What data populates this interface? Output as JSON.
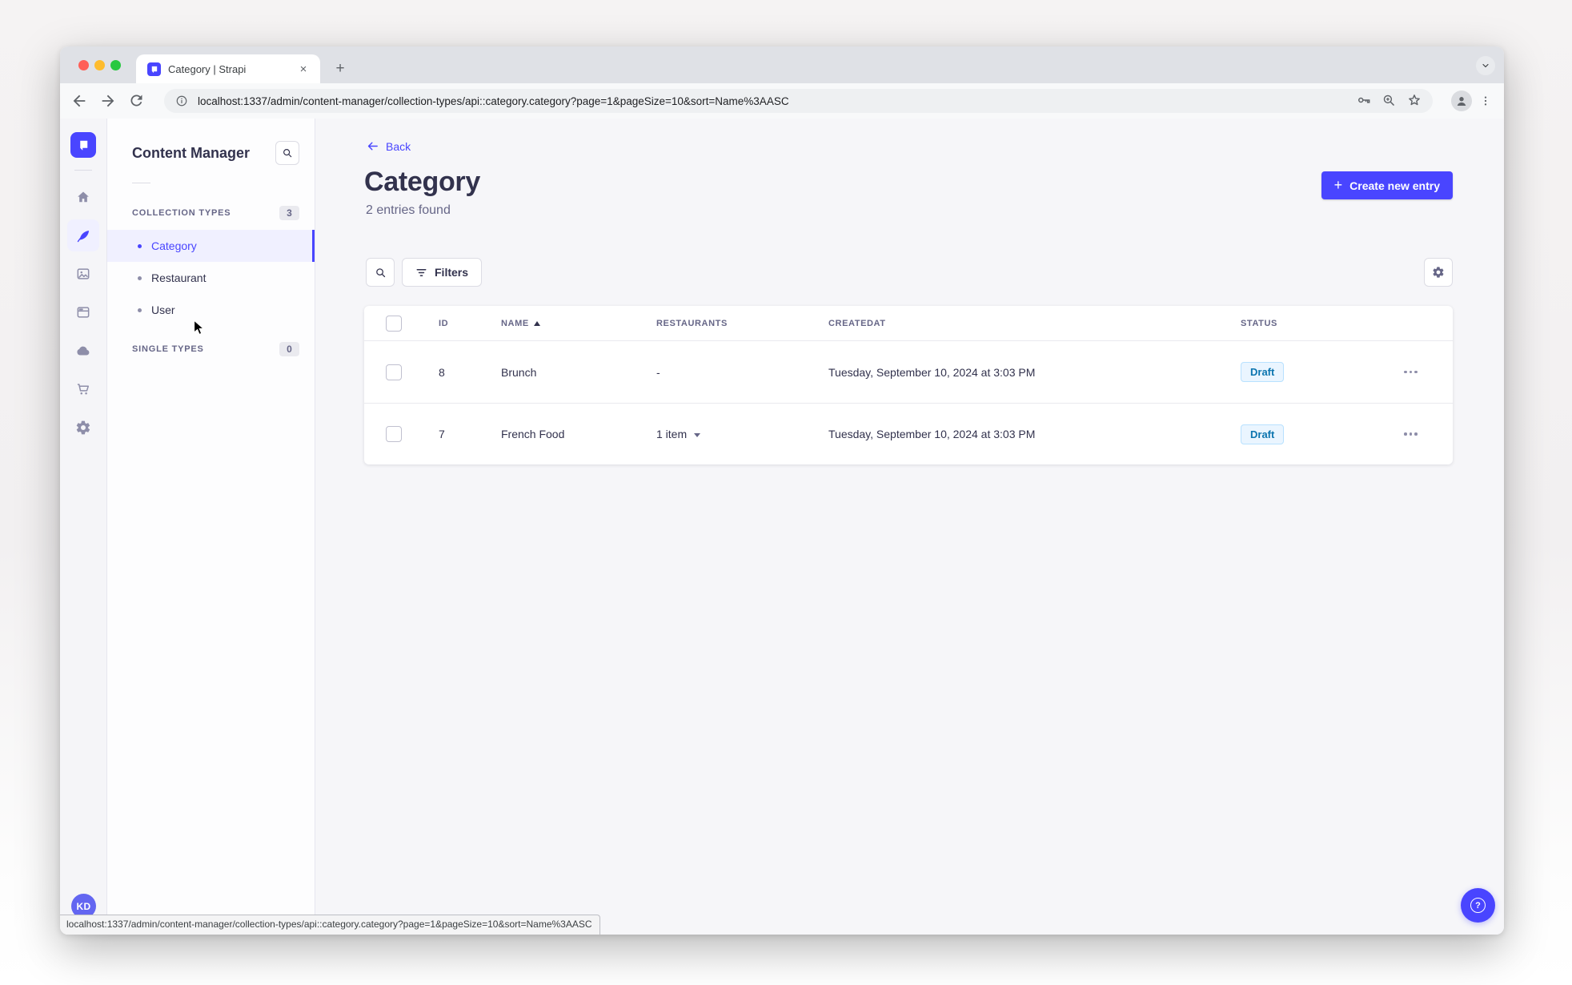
{
  "browser": {
    "tab_title": "Category | Strapi",
    "close_glyph": "×",
    "newtab_glyph": "+",
    "url": "localhost:1337/admin/content-manager/collection-types/api::category.category?page=1&pageSize=10&sort=Name%3AASC",
    "status_url": "localhost:1337/admin/content-manager/collection-types/api::category.category?page=1&pageSize=10&sort=Name%3AASC"
  },
  "rail": {
    "avatar_initials": "KD",
    "icons": [
      "strapi-logo",
      "home",
      "content-manager-feather",
      "media-library",
      "content-type-builder-layout",
      "deploy-cloud",
      "marketplace-cart",
      "settings-gear"
    ]
  },
  "subnav": {
    "title": "Content Manager",
    "collection_types_label": "COLLECTION TYPES",
    "collection_types_count": "3",
    "items": [
      {
        "label": "Category"
      },
      {
        "label": "Restaurant"
      },
      {
        "label": "User"
      }
    ],
    "single_types_label": "SINGLE TYPES",
    "single_types_count": "0"
  },
  "main": {
    "back_label": "Back",
    "title": "Category",
    "subtitle": "2 entries found",
    "create_button_label": "Create new entry",
    "create_plus_glyph": "+",
    "filters_label": "Filters",
    "help_glyph": "?",
    "table": {
      "headers": {
        "id": "ID",
        "name": "NAME",
        "restaurants": "RESTAURANTS",
        "created": "CREATEDAT",
        "status": "STATUS"
      },
      "sort": {
        "column": "NAME",
        "direction": "ascending"
      },
      "rows": [
        {
          "id": "8",
          "name": "Brunch",
          "restaurants": "-",
          "created": "Tuesday, September 10, 2024 at 3:03 PM",
          "status": "Draft"
        },
        {
          "id": "7",
          "name": "French Food",
          "restaurants": "1 item",
          "created": "Tuesday, September 10, 2024 at 3:03 PM",
          "status": "Draft"
        }
      ]
    }
  },
  "colors": {
    "accent": "#4945ff",
    "active_item_bg": "#f0f0ff",
    "draft_bg": "#eaf5ff",
    "draft_border": "#b8e1ff",
    "draft_text": "#0c75af",
    "main_bg": "#f6f6f9"
  }
}
